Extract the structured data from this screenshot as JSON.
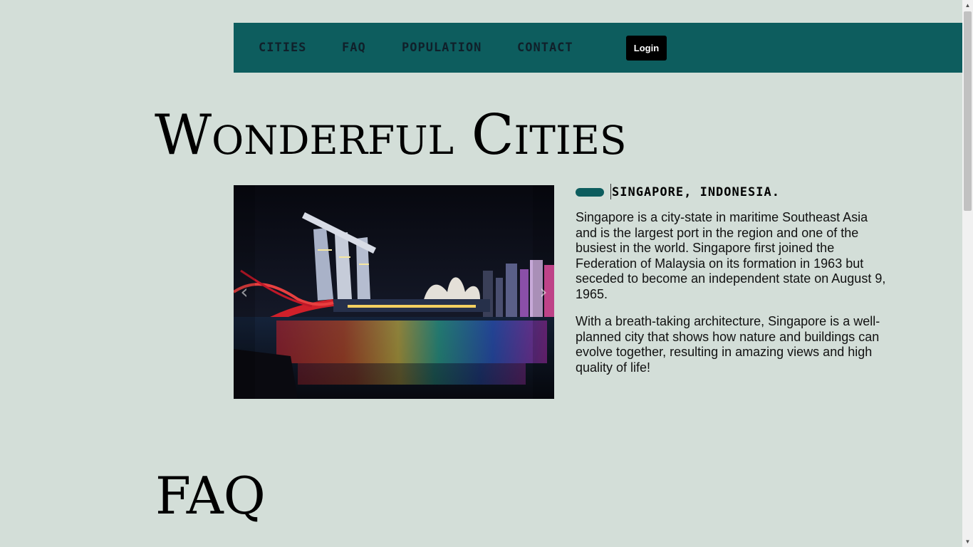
{
  "nav": {
    "items": [
      "CITIES",
      "FAQ",
      "POPULATION",
      "CONTACT"
    ],
    "login_label": "Login"
  },
  "main": {
    "title": "Wonderful Cities",
    "carousel": {
      "image": "singapore-marina-bay-night-photo",
      "prev_icon": "chevron-left-icon",
      "next_icon": "chevron-right-icon"
    },
    "city": {
      "heading": "SINGAPORE, INDONESIA.",
      "paragraphs": [
        "Singapore is a city-state in maritime Southeast Asia and is the largest port in the region and one of the busiest in the world. Singapore first joined the Federation of Malaysia on its formation in 1963 but seceded to become an independent state on August 9, 1965.",
        "With a breath-taking architecture, Singapore is a well-planned city that shows how nature and buildings can evolve together, resulting in amazing views and high quality of life!"
      ]
    }
  },
  "faq": {
    "title": "FAQ"
  },
  "colors": {
    "background": "#d3ded8",
    "nav_background": "#0d5d5e",
    "accent": "#0d5d5e",
    "login_background": "#000000"
  }
}
